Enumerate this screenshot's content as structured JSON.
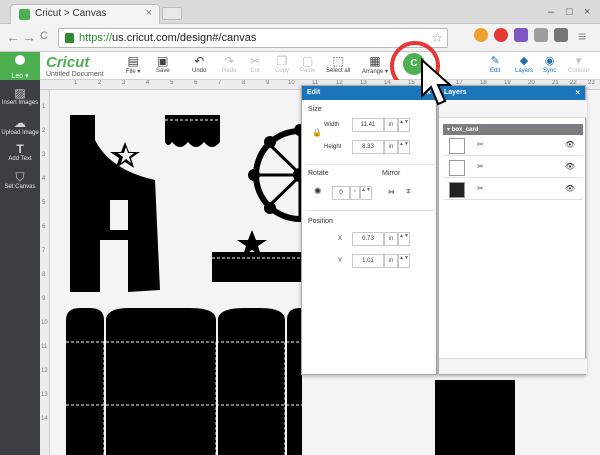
{
  "browser": {
    "tab_title": "Cricut > Canvas",
    "tab_close": "×",
    "back": "←",
    "forward": "→",
    "reload": "C",
    "url_protocol": "https://",
    "url_rest": "us.cricut.com/design#/canvas",
    "star": "☆"
  },
  "app": {
    "user_label": "Leo ▾",
    "logo": "Cricut",
    "document_name": "Untitled Document",
    "accent_color": "#4caf50",
    "panel_color": "#1a75bb"
  },
  "toolbar": {
    "file": "File ▾",
    "save": "Save",
    "undo": "Undo",
    "redo": "Redo",
    "cut": "Cut",
    "copy": "Copy",
    "paste": "Paste",
    "select_all": "Select all",
    "arrange": "Arrange ▾",
    "go": "Go",
    "go_glyph": "C",
    "edit": "Edit",
    "layers": "Layers",
    "sync": "Sync",
    "contour": "Contour"
  },
  "sidebar": {
    "items": [
      {
        "label": "Insert Images"
      },
      {
        "label": "Upload Image"
      },
      {
        "label": "Add Text"
      },
      {
        "label": "Set Canvas"
      }
    ]
  },
  "ruler": {
    "top": [
      "1",
      "2",
      "3",
      "4",
      "5",
      "6",
      "7",
      "8",
      "9",
      "10",
      "11",
      "12",
      "13",
      "14",
      "15",
      "16",
      "17",
      "18",
      "19",
      "20",
      "21",
      "22",
      "23"
    ],
    "left": [
      "1",
      "2",
      "3",
      "4",
      "5",
      "6",
      "7",
      "8",
      "9",
      "10",
      "11",
      "12",
      "13",
      "14"
    ]
  },
  "edit_panel": {
    "title": "Edit",
    "close": "×",
    "size_label": "Size",
    "width_label": "Width",
    "width_value": "11.41",
    "height_label": "Height",
    "height_value": "8.33",
    "unit": "in",
    "rotate_label": "Rotate",
    "rotate_value": "0",
    "degree": "°",
    "mirror_label": "Mirror",
    "position_label": "Position",
    "x_label": "X",
    "x_value": "0.73",
    "y_label": "Y",
    "y_value": "1.01"
  },
  "layers_panel": {
    "title": "Layers",
    "close": "×",
    "group_name": "box_card",
    "eye": "👁",
    "scissors": "✂"
  }
}
